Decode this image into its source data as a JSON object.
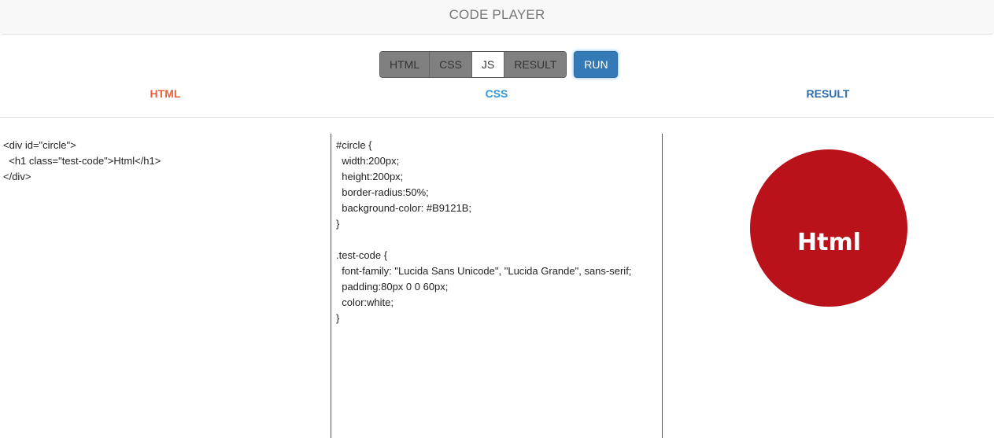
{
  "header": {
    "title": "CODE PLAYER"
  },
  "toolbar": {
    "tabs": [
      {
        "label": "HTML",
        "active": false
      },
      {
        "label": "CSS",
        "active": false
      },
      {
        "label": "JS",
        "active": true
      },
      {
        "label": "RESULT",
        "active": false
      }
    ],
    "run_label": "RUN"
  },
  "panes": {
    "html": {
      "label": "HTML",
      "lines": [
        "<div id=\"circle\">",
        "  <h1 class=\"test-code\">Html</h1>",
        "</div>"
      ]
    },
    "css": {
      "label": "CSS",
      "lines": [
        "#circle {",
        "  width:200px;",
        "  height:200px;",
        "  border-radius:50%;",
        "  background-color: #B9121B;",
        "}",
        "",
        ".test-code {",
        "  font-family: \"Lucida Sans Unicode\", \"Lucida Grande\", sans-serif;",
        "  padding:80px 0 0 60px;",
        "  color:white;",
        "}"
      ]
    },
    "result": {
      "label": "RESULT",
      "circle_text": "Html",
      "circle_color": "#B9121B"
    }
  },
  "colors": {
    "html_label": "#e8613c",
    "css_label": "#3498db",
    "result_label": "#2c6db0",
    "run_button": "#337ab7"
  }
}
